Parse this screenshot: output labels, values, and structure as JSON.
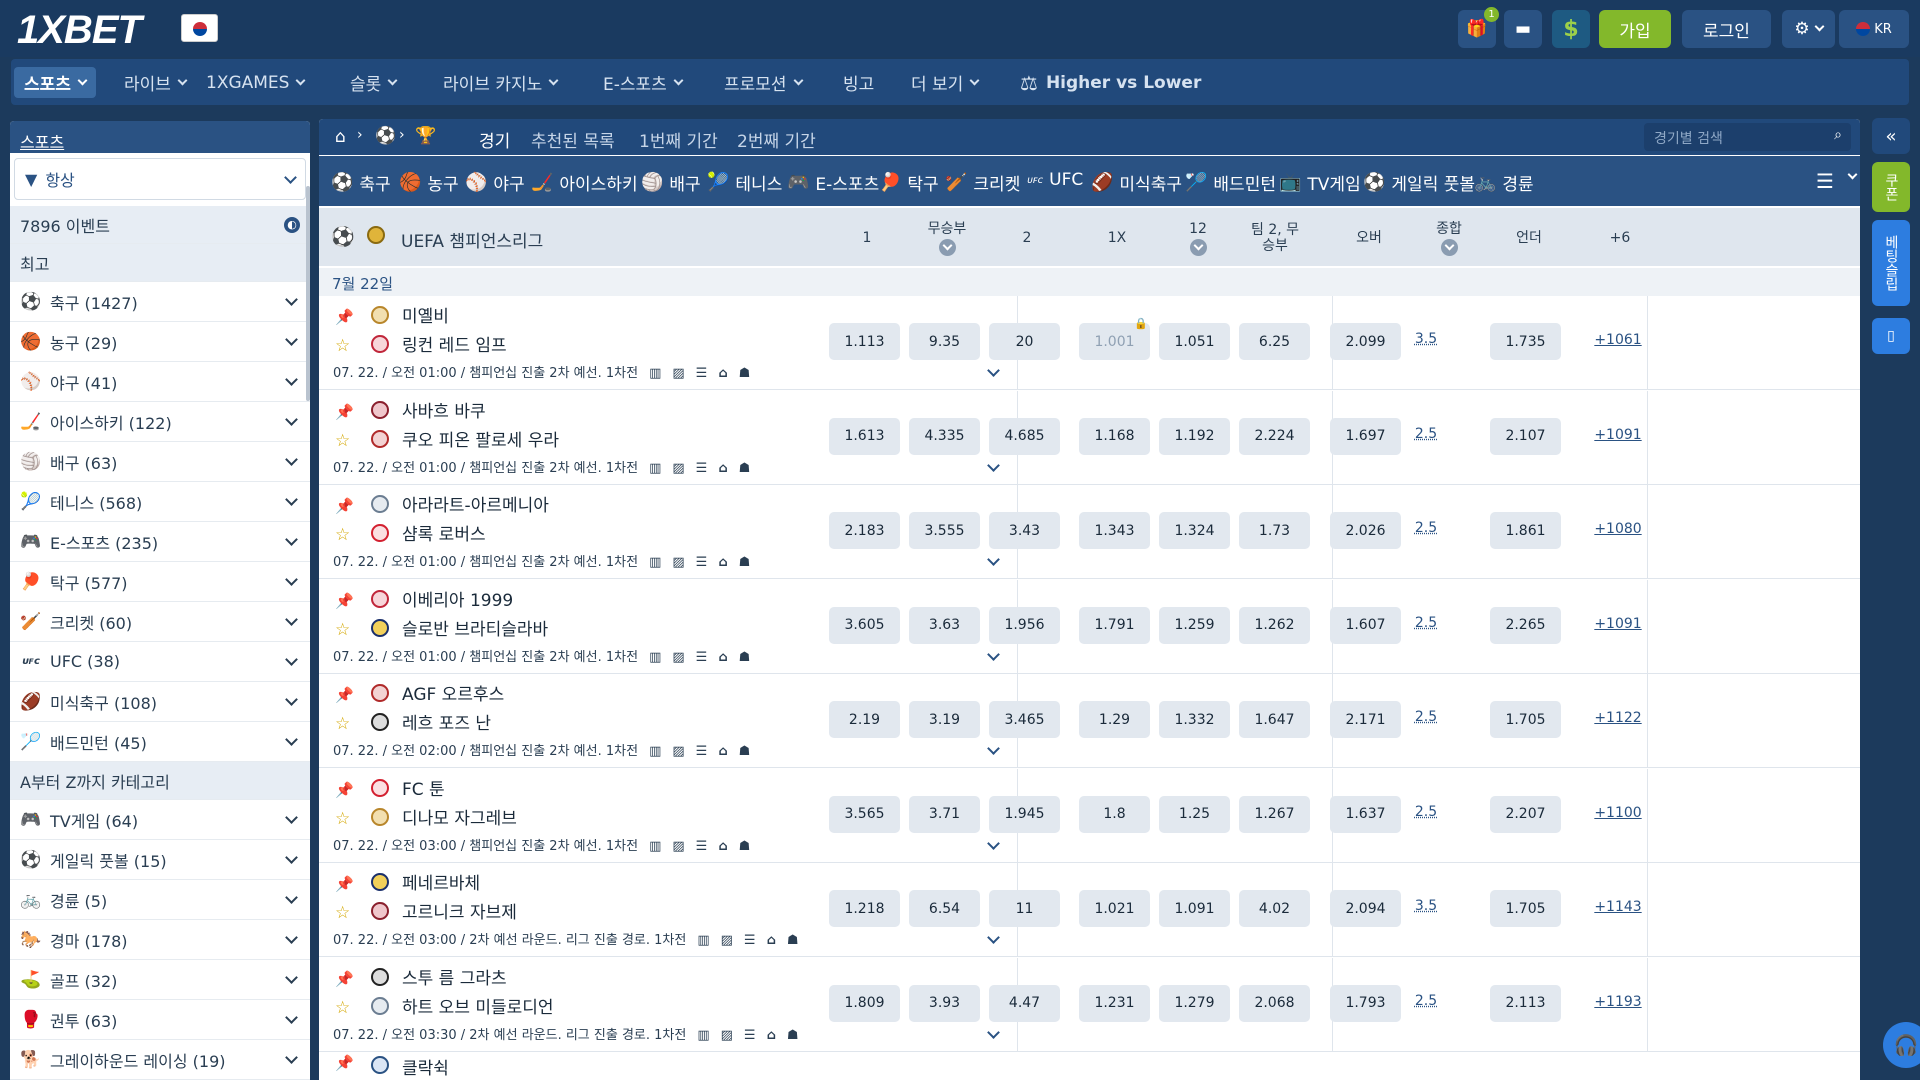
{
  "brand": {
    "logo": "1XBET",
    "lang": "KR"
  },
  "header": {
    "signup": "가입",
    "login": "로그인",
    "gift_badge": "1"
  },
  "nav": [
    {
      "label": "스포츠",
      "active": true,
      "chev": true
    },
    {
      "label": "라이브",
      "chev": true
    },
    {
      "label": "1XGAMES",
      "chev": true
    },
    {
      "label": "슬롯",
      "chev": true
    },
    {
      "label": "라이브 카지노",
      "chev": true
    },
    {
      "label": "E-스포츠",
      "chev": true
    },
    {
      "label": "프로모션",
      "chev": true
    },
    {
      "label": "빙고",
      "chev": false
    },
    {
      "label": "더 보기",
      "chev": true
    },
    {
      "label": "Higher vs Lower",
      "chev": false
    }
  ],
  "sidebar": {
    "title": "스포츠",
    "filter": "항상",
    "events": "7896 이벤트",
    "top": "최고",
    "sports": [
      {
        "icon": "⚽",
        "label": "축구 (1427)"
      },
      {
        "icon": "🏀",
        "label": "농구 (29)"
      },
      {
        "icon": "⚾",
        "label": "야구 (41)"
      },
      {
        "icon": "🏒",
        "label": "아이스하키 (122)"
      },
      {
        "icon": "🏐",
        "label": "배구 (63)"
      },
      {
        "icon": "🎾",
        "label": "테니스 (568)"
      },
      {
        "icon": "🎮",
        "label": "E-스포츠 (235)"
      },
      {
        "icon": "🏓",
        "label": "탁구 (577)"
      },
      {
        "icon": "🏏",
        "label": "크리켓 (60)"
      },
      {
        "icon": "ufc",
        "label": "UFC (38)"
      },
      {
        "icon": "🏈",
        "label": "미식축구 (108)"
      },
      {
        "icon": "🏸",
        "label": "배드민턴 (45)"
      }
    ],
    "az_title": "A부터 Z까지 카테고리",
    "az": [
      {
        "icon": "🎮",
        "label": "TV게임 (64)"
      },
      {
        "icon": "⚽",
        "label": "게일릭 풋볼 (15)"
      },
      {
        "icon": "🚲",
        "label": "경륜 (5)"
      },
      {
        "icon": "🐎",
        "label": "경마 (178)"
      },
      {
        "icon": "⛳",
        "label": "골프 (32)"
      },
      {
        "icon": "🥊",
        "label": "권투 (63)"
      },
      {
        "icon": "🐕",
        "label": "그레이하운드 레이싱 (19)"
      }
    ]
  },
  "main": {
    "tabs": [
      "경기",
      "추천된 목록",
      "1번째 기간",
      "2번째 기간"
    ],
    "search_placeholder": "경기별 검색",
    "sports": [
      {
        "icon": "⚽",
        "label": "축구"
      },
      {
        "icon": "🏀",
        "label": "농구"
      },
      {
        "icon": "⚾",
        "label": "야구"
      },
      {
        "icon": "🏒",
        "label": "아이스하키"
      },
      {
        "icon": "🏐",
        "label": "배구"
      },
      {
        "icon": "🎾",
        "label": "테니스"
      },
      {
        "icon": "🎮",
        "label": "E-스포츠"
      },
      {
        "icon": "🏓",
        "label": "탁구"
      },
      {
        "icon": "🏏",
        "label": "크리켓"
      },
      {
        "icon": "ufc",
        "label": "UFC"
      },
      {
        "icon": "🏈",
        "label": "미식축구"
      },
      {
        "icon": "🏸",
        "label": "배드민턴"
      },
      {
        "icon": "📺",
        "label": "TV게임"
      },
      {
        "icon": "⚽",
        "label": "게일릭 풋볼"
      },
      {
        "icon": "🚲",
        "label": "경륜"
      }
    ],
    "league": "UEFA 챔피언스리그",
    "columns": [
      "1",
      "무승부",
      "2",
      "1X",
      "12",
      "팀 2, 무승부",
      "오버",
      "종합",
      "언더",
      "+6"
    ],
    "date": "7월 22일",
    "matches": [
      {
        "t1": "미옐비",
        "t2": "링컨 레드 임프",
        "info": "07. 22. / 오전 01:00 / 챔피언십 진출 2차 예선. 1차전",
        "odds": [
          "1.113",
          "9.35",
          "20",
          "1.001",
          "1.051",
          "6.25",
          "2.099",
          "3.5",
          "1.735"
        ],
        "locked": true,
        "more": "+1061"
      },
      {
        "t1": "사바흐 바쿠",
        "t2": "쿠오 피온 팔로세 우라",
        "info": "07. 22. / 오전 01:00 / 챔피언십 진출 2차 예선. 1차전",
        "odds": [
          "1.613",
          "4.335",
          "4.685",
          "1.168",
          "1.192",
          "2.224",
          "1.697",
          "2.5",
          "2.107"
        ],
        "locked": false,
        "more": "+1091"
      },
      {
        "t1": "아라라트-아르메니아",
        "t2": "샴록 로버스",
        "info": "07. 22. / 오전 01:00 / 챔피언십 진출 2차 예선. 1차전",
        "odds": [
          "2.183",
          "3.555",
          "3.43",
          "1.343",
          "1.324",
          "1.73",
          "2.026",
          "2.5",
          "1.861"
        ],
        "locked": false,
        "more": "+1080"
      },
      {
        "t1": "이베리아 1999",
        "t2": "슬로반 브라티슬라바",
        "info": "07. 22. / 오전 01:00 / 챔피언십 진출 2차 예선. 1차전",
        "odds": [
          "3.605",
          "3.63",
          "1.956",
          "1.791",
          "1.259",
          "1.262",
          "1.607",
          "2.5",
          "2.265"
        ],
        "locked": false,
        "more": "+1091"
      },
      {
        "t1": "AGF 오르후스",
        "t2": "레흐 포즈 난",
        "info": "07. 22. / 오전 02:00 / 챔피언십 진출 2차 예선. 1차전",
        "odds": [
          "2.19",
          "3.19",
          "3.465",
          "1.29",
          "1.332",
          "1.647",
          "2.171",
          "2.5",
          "1.705"
        ],
        "locked": false,
        "more": "+1122"
      },
      {
        "t1": "FC 툰",
        "t2": "디나모 자그레브",
        "info": "07. 22. / 오전 03:00 / 챔피언십 진출 2차 예선. 1차전",
        "odds": [
          "3.565",
          "3.71",
          "1.945",
          "1.8",
          "1.25",
          "1.267",
          "1.637",
          "2.5",
          "2.207"
        ],
        "locked": false,
        "more": "+1100"
      },
      {
        "t1": "페네르바체",
        "t2": "고르니크 자브제",
        "info": "07. 22. / 오전 03:00 / 2차 예선 라운드. 리그 진출 경로. 1차전",
        "odds": [
          "1.218",
          "6.54",
          "11",
          "1.021",
          "1.091",
          "4.02",
          "2.094",
          "3.5",
          "1.705"
        ],
        "locked": false,
        "more": "+1143"
      },
      {
        "t1": "스투 름 그라츠",
        "t2": "하트 오브 미들로디언",
        "info": "07. 22. / 오전 03:30 / 2차 예선 라운드. 리그 진출 경로. 1차전",
        "odds": [
          "1.809",
          "3.93",
          "4.47",
          "1.231",
          "1.279",
          "2.068",
          "1.793",
          "2.5",
          "2.113"
        ],
        "locked": false,
        "more": "+1193"
      }
    ],
    "last_team": "클락쉭"
  },
  "rail": {
    "coupon": "쿠폰",
    "betslip": "베팅슬립"
  }
}
